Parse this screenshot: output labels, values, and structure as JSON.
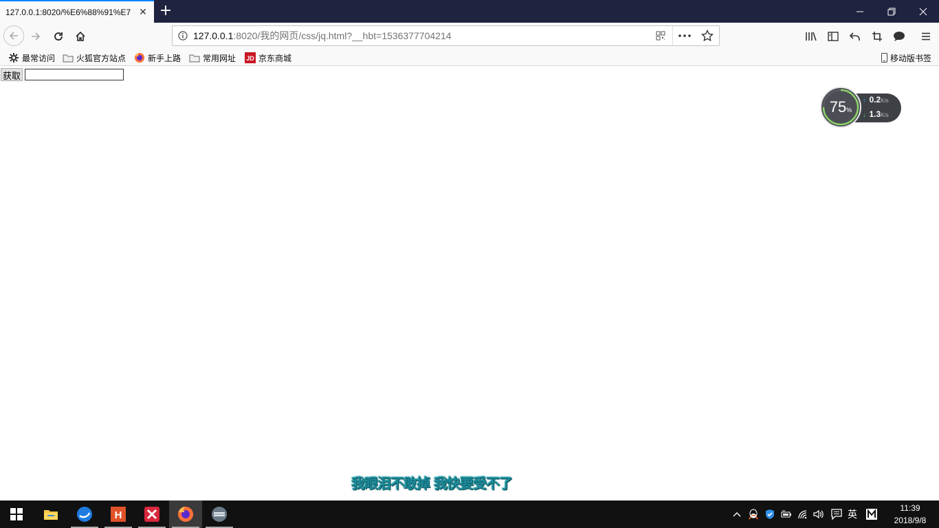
{
  "browser": {
    "tab_title": "127.0.0.1:8020/%E6%88%91%E7",
    "url_host": "127.0.0.1",
    "url_rest": ":8020/我的网页/css/jq.html?__hbt=1536377704214"
  },
  "bookmarks": [
    {
      "label": "最常访问",
      "icon": "gear-icon"
    },
    {
      "label": "火狐官方站点",
      "icon": "folder-icon"
    },
    {
      "label": "新手上路",
      "icon": "firefox-icon"
    },
    {
      "label": "常用网址",
      "icon": "folder-icon"
    },
    {
      "label": "京东商城",
      "icon": "jd-icon"
    }
  ],
  "mobile_bookmarks": "移动版书签",
  "page": {
    "get_button": "获取",
    "input_value": ""
  },
  "speed_widget": {
    "percent": "75",
    "percent_sign": "%",
    "upload": "0.2",
    "download": "1.3",
    "unit": "K/s"
  },
  "lyric": "我眼泪不敢掉 我快要受不了",
  "taskbar": {
    "ime": "英",
    "time": "11:39",
    "date": "2018/9/8"
  },
  "colors": {
    "tabbar": "#1f2340",
    "accent": "#0a84ff"
  }
}
